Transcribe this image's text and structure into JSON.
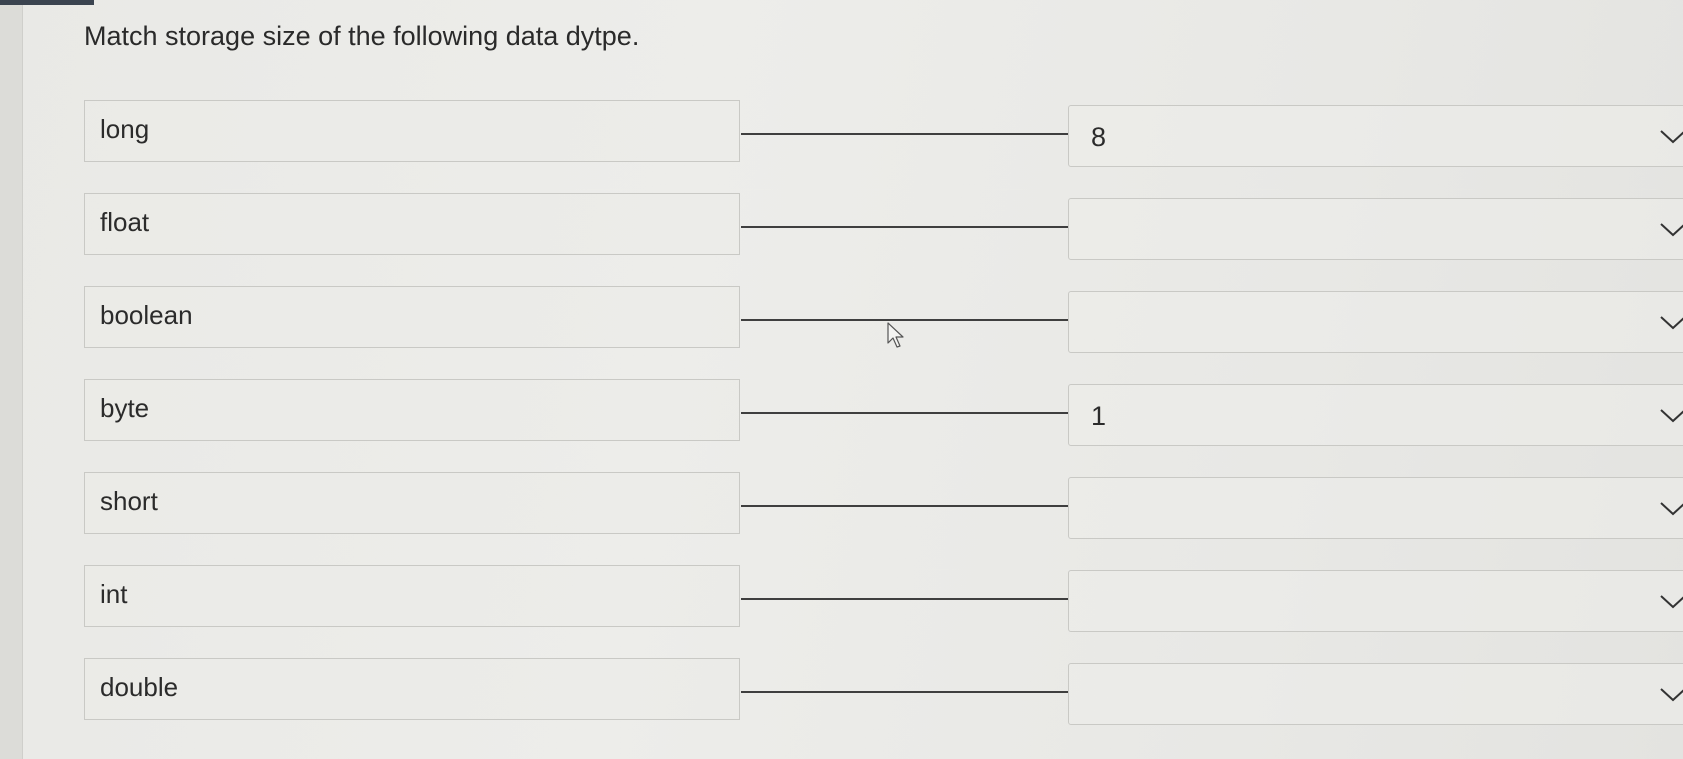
{
  "question": {
    "text": "Match storage size of the following data dytpe."
  },
  "pairs": [
    {
      "term": "long",
      "selected": "8"
    },
    {
      "term": "float",
      "selected": ""
    },
    {
      "term": "boolean",
      "selected": ""
    },
    {
      "term": "byte",
      "selected": "1"
    },
    {
      "term": "short",
      "selected": ""
    },
    {
      "term": "int",
      "selected": ""
    },
    {
      "term": "double",
      "selected": ""
    }
  ],
  "icons": {
    "dropdown": "chevron-down-icon",
    "cursor": "mouse-pointer-icon"
  },
  "colors": {
    "connector": "#3f3f3f",
    "border": "#c9c9c5",
    "text": "#2b2b2b"
  }
}
